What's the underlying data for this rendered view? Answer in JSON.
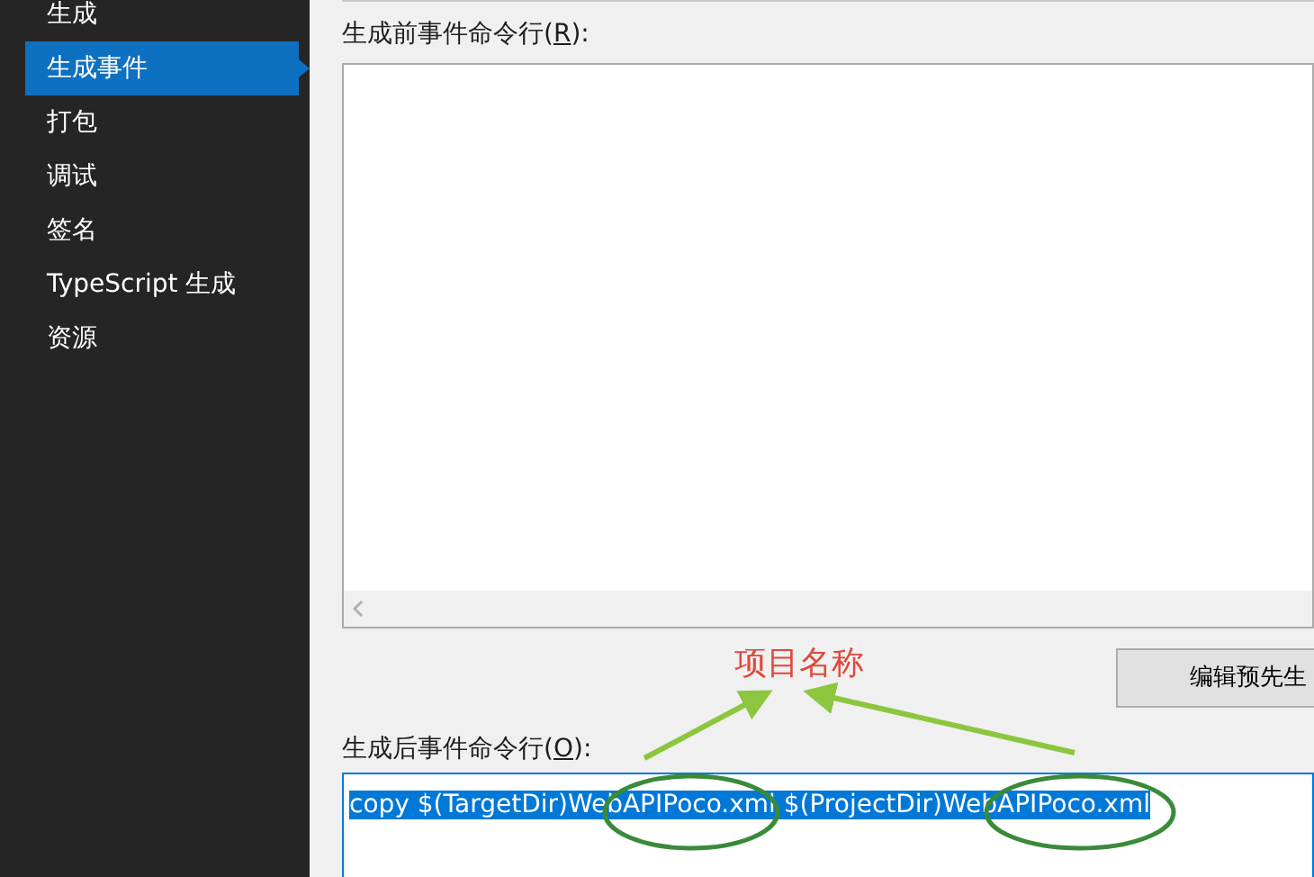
{
  "sidebar": {
    "items": [
      {
        "label": "生成",
        "selected": false
      },
      {
        "label": "生成事件",
        "selected": true
      },
      {
        "label": "打包",
        "selected": false
      },
      {
        "label": "调试",
        "selected": false
      },
      {
        "label": "签名",
        "selected": false
      },
      {
        "label": "TypeScript 生成",
        "selected": false
      },
      {
        "label": "资源",
        "selected": false
      }
    ]
  },
  "pre_build": {
    "label_before": "生成前事件命令行(",
    "mnemonic": "R",
    "label_after": "):",
    "button": "编辑预先生"
  },
  "post_build": {
    "label_before": "生成后事件命令行(",
    "mnemonic": "O",
    "label_after": "):",
    "value": "copy $(TargetDir)WebAPIPoco.xml $(ProjectDir)WebAPIPoco.xml",
    "value_selected": true
  },
  "annotation": {
    "text": "项目名称"
  }
}
